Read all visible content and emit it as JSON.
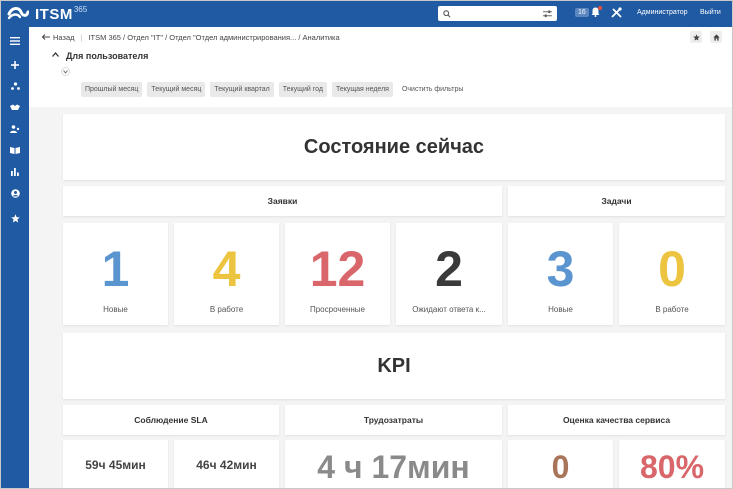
{
  "app": {
    "logo_text": "ITSM",
    "logo_sup": "365"
  },
  "topbar": {
    "notification_count": "16",
    "user_label": "Администратор",
    "exit_label": "Выйти"
  },
  "sidebar": {
    "icons": [
      "menu-icon",
      "plus-icon",
      "org-structure-icon",
      "handshake-icon",
      "users-icon",
      "book-icon",
      "chart-icon",
      "user-circle-icon",
      "star-icon"
    ]
  },
  "breadcrumb": {
    "back_label": "Назад",
    "items": [
      "ITSM 365 / Отдел \"IT\" / Отдел \"Отдел администрирования... / Аналитика"
    ]
  },
  "section": {
    "title": "Для пользователя"
  },
  "filters": {
    "buttons": [
      "Прошлый месяц",
      "Текущий месяц",
      "Текущий квартал",
      "Текущий год",
      "Текущая неделя"
    ],
    "clear_label": "Очистить фильтры"
  },
  "dashboard": {
    "state_title": "Состояние сейчас",
    "requests_title": "Заявки",
    "tasks_title": "Задачи",
    "tiles": [
      {
        "value": "1",
        "label": "Новые",
        "color": "#5b95cf"
      },
      {
        "value": "4",
        "label": "В работе",
        "color": "#ecc440"
      },
      {
        "value": "12",
        "label": "Просроченные",
        "color": "#d9666a"
      },
      {
        "value": "2",
        "label": "Ожидают ответа к...",
        "color": "#3a3a3a"
      },
      {
        "value": "3",
        "label": "Новые",
        "color": "#5b95cf"
      },
      {
        "value": "0",
        "label": "В работе",
        "color": "#ecc440"
      }
    ],
    "kpi_title": "KPI",
    "sla_title": "Соблюдение SLA",
    "labor_title": "Трудозатраты",
    "quality_title": "Оценка качества сервиса",
    "sla_values": [
      "59ч 45мин",
      "46ч 42мин"
    ],
    "labor_value": "4 ч 17мин",
    "quality_values": [
      {
        "value": "0",
        "color": "#a8755a"
      },
      {
        "value": "80%",
        "color": "#d9666a"
      }
    ]
  }
}
